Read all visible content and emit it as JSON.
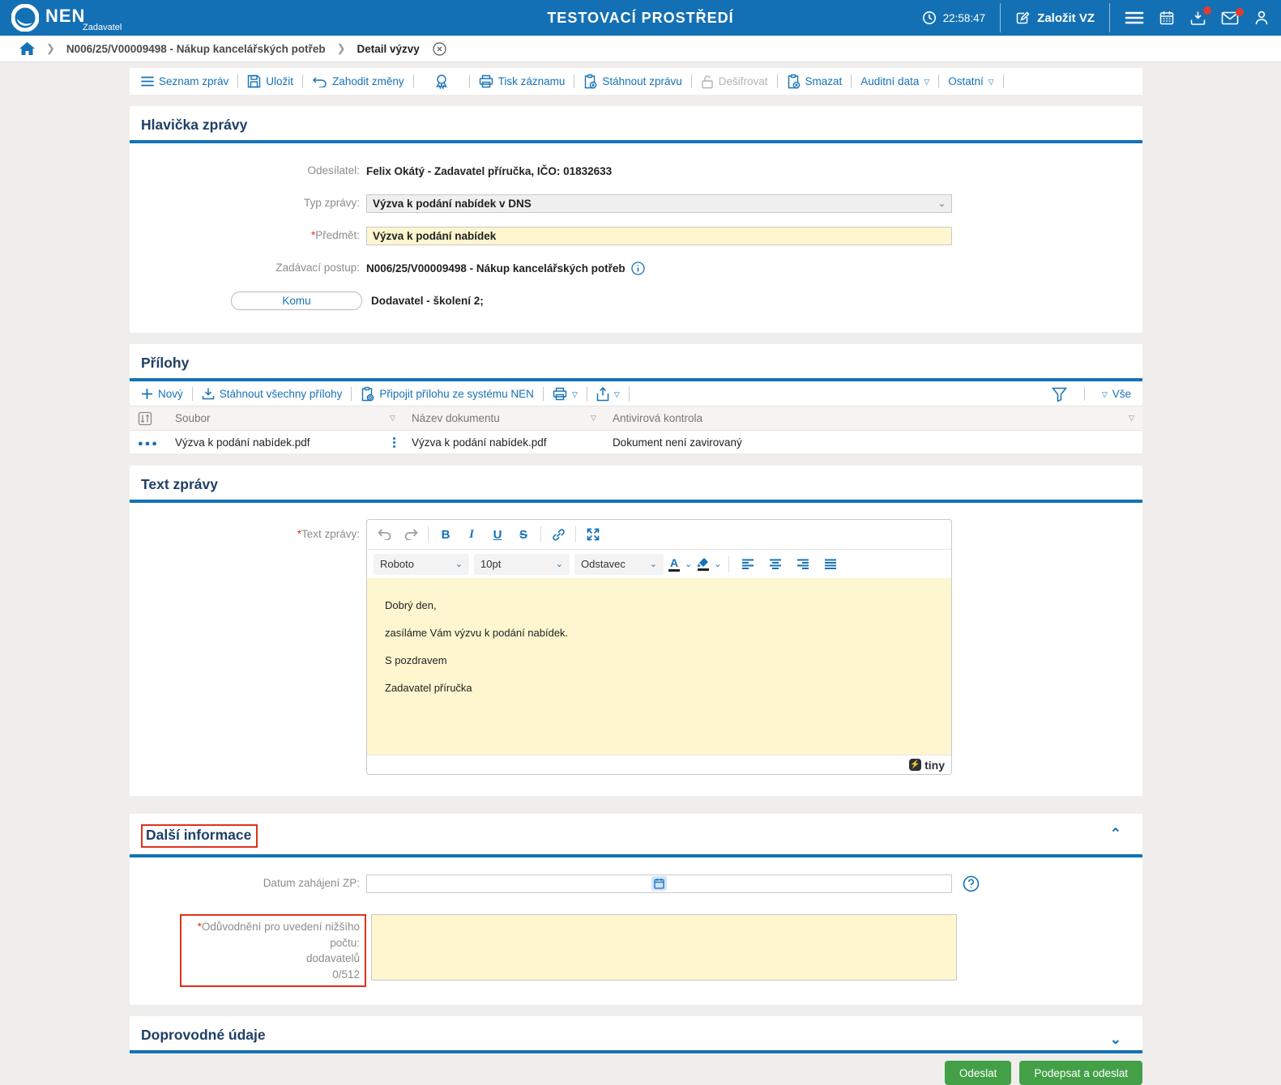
{
  "required_marker": "*",
  "topbar": {
    "logo": "NEN",
    "logo_sub": "Zadavatel",
    "env_title": "TESTOVACÍ PROSTŘEDÍ",
    "clock": "22:58:47",
    "create_vz": "Založit VZ"
  },
  "breadcrumb": {
    "procedure": "N006/25/V00009498 - Nákup kancelářských potřeb",
    "current": "Detail výzvy"
  },
  "toolbar": {
    "seznam_zprav": "Seznam zpráv",
    "ulozit": "Uložit",
    "zahodit_zmeny": "Zahodit změny",
    "tisk_zaznamu": "Tisk záznamu",
    "stahnout_zpravu": "Stáhnout zprávu",
    "desifrovat": "Dešifrovat",
    "smazat": "Smazat",
    "auditni_data": "Auditní data",
    "ostatni": "Ostatní"
  },
  "header_section": {
    "title": "Hlavička zprávy",
    "odesilatel_label": "Odesílatel:",
    "odesilatel_value": "Felix Okátý - Zadavatel příručka, IČO: 01832633",
    "typ_label": "Typ zprávy:",
    "typ_value": "Výzva k podání nabídek v DNS",
    "predmet_label": "Předmět:",
    "predmet_value": "Výzva k podání nabídek",
    "postup_label": "Zadávací postup:",
    "postup_value": "N006/25/V00009498 - Nákup kancelářských potřeb",
    "komu_button": "Komu",
    "komu_value": "Dodavatel - školení 2;"
  },
  "attachments": {
    "title": "Přílohy",
    "novy": "Nový",
    "stahnout_vse": "Stáhnout všechny přílohy",
    "pripojit": "Připojit přílohu ze systému NEN",
    "vse": "Vše",
    "col_soubor": "Soubor",
    "col_nazev": "Název dokumentu",
    "col_antivir": "Antivirová kontrola",
    "rows": [
      {
        "soubor": "Výzva k podání nabídek.pdf",
        "nazev": "Výzva k podání nabídek.pdf",
        "antivir": "Dokument není zavirovaný"
      }
    ]
  },
  "message_body": {
    "title": "Text zprávy",
    "label": "Text zprávy:",
    "font_select": "Roboto",
    "size_select": "10pt",
    "block_select": "Odstavec",
    "paragraphs": [
      "Dobrý den,",
      "zasíláme Vám výzvu k podání nabídek.",
      "S pozdravem",
      "Zadavatel příručka"
    ],
    "tiny_brand": "tiny"
  },
  "additional": {
    "title": "Další informace",
    "datum_label": "Datum zahájení ZP:",
    "oduvodneni_line1": "Odůvodnění pro uvedení nižšího počtu:",
    "oduvodneni_line2": "dodavatelů",
    "oduvodneni_counter": "0/512"
  },
  "accompanying": {
    "title": "Doprovodné údaje"
  },
  "footer": {
    "odeslat": "Odeslat",
    "podepsat_a_odeslat": "Podepsat a odeslat"
  },
  "colors": {
    "topbar_blue": "#1470b4",
    "accent_blue": "#1572b6",
    "section_navy": "#1f3f66",
    "required_yellow": "#fdf6cf",
    "alert_red": "#e0301e",
    "button_green": "#43a047"
  }
}
